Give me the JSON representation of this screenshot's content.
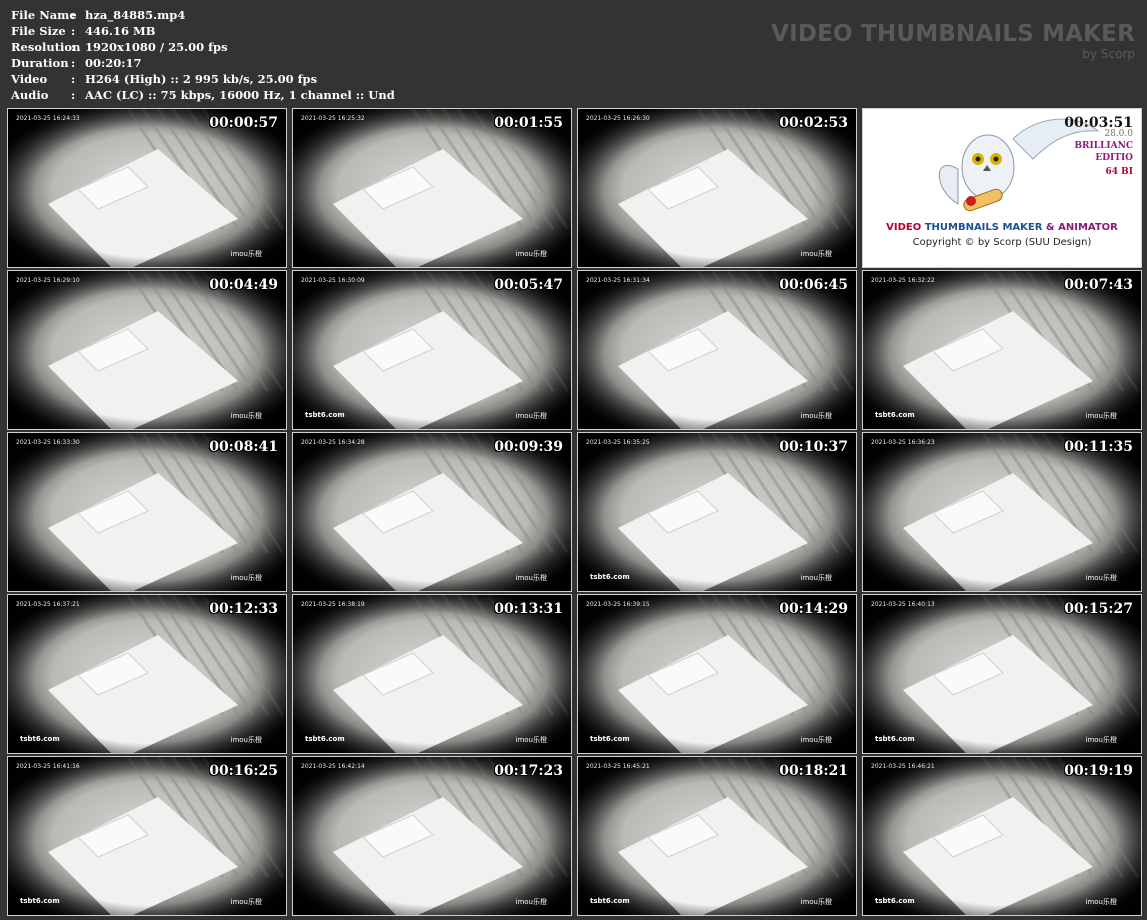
{
  "meta": [
    {
      "key": "File Name",
      "sep": ":",
      "value": "hza_84885.mp4"
    },
    {
      "key": "File Size",
      "sep": ":",
      "value": "446.16 MB"
    },
    {
      "key": "Resolution",
      "sep": ":",
      "value": "1920x1080 / 25.00 fps"
    },
    {
      "key": "Duration",
      "sep": ":",
      "value": "00:20:17"
    },
    {
      "key": "Video",
      "sep": ":",
      "value": "H264 (High) :: 2 995 kb/s, 25.00 fps"
    },
    {
      "key": "Audio",
      "sep": ":",
      "value": "AAC (LC) :: 75 kbps, 16000 Hz, 1 channel :: Und"
    }
  ],
  "brand": {
    "title": "VIDEO THUMBNAILS MAKER",
    "subtitle": "by Scorp"
  },
  "thumbnail_osd": "2021-03-25 16:24:33",
  "thumbnail_watermark": "imou乐橙",
  "thumbnails": [
    {
      "timestamp": "00:00:57",
      "osd": "2021-03-25 16:24:33",
      "watermark": "imou乐橙"
    },
    {
      "timestamp": "00:01:55",
      "osd": "2021-03-25 16:25:32",
      "watermark": "imou乐橙"
    },
    {
      "timestamp": "00:02:53",
      "osd": "2021-03-25 16:26:30",
      "watermark": "imou乐橙"
    },
    {
      "timestamp": "00:03:51",
      "logo": true
    },
    {
      "timestamp": "00:04:49",
      "osd": "2021-03-25 16:29:10",
      "watermark": "imou乐橙"
    },
    {
      "timestamp": "00:05:47",
      "osd": "2021-03-25 16:30:09",
      "watermark": "imou乐橙",
      "site": "tsbt6.com"
    },
    {
      "timestamp": "00:06:45",
      "osd": "2021-03-25 16:31:34",
      "watermark": "imou乐橙"
    },
    {
      "timestamp": "00:07:43",
      "osd": "2021-03-25 16:32:22",
      "watermark": "imou乐橙",
      "site": "tsbt6.com"
    },
    {
      "timestamp": "00:08:41",
      "osd": "2021-03-25 16:33:30",
      "watermark": "imou乐橙"
    },
    {
      "timestamp": "00:09:39",
      "osd": "2021-03-25 16:34:28",
      "watermark": "imou乐橙"
    },
    {
      "timestamp": "00:10:37",
      "osd": "2021-03-25 16:35:25",
      "watermark": "imou乐橙",
      "site": "tsbt6.com"
    },
    {
      "timestamp": "00:11:35",
      "osd": "2021-03-25 16:36:23",
      "watermark": "imou乐橙"
    },
    {
      "timestamp": "00:12:33",
      "osd": "2021-03-25 16:37:21",
      "watermark": "imou乐橙",
      "site": "tsbt6.com"
    },
    {
      "timestamp": "00:13:31",
      "osd": "2021-03-25 16:38:19",
      "watermark": "imou乐橙",
      "site": "tsbt6.com"
    },
    {
      "timestamp": "00:14:29",
      "osd": "2021-03-25 16:39:15",
      "watermark": "imou乐橙",
      "site": "tsbt6.com"
    },
    {
      "timestamp": "00:15:27",
      "osd": "2021-03-25 16:40:13",
      "watermark": "imou乐橙",
      "site": "tsbt6.com"
    },
    {
      "timestamp": "00:16:25",
      "osd": "2021-03-25 16:41:16",
      "watermark": "imou乐橙",
      "site": "tsbt6.com"
    },
    {
      "timestamp": "00:17:23",
      "osd": "2021-03-25 16:42:14",
      "watermark": "imou乐橙"
    },
    {
      "timestamp": "00:18:21",
      "osd": "2021-03-25 16:45:21",
      "watermark": "imou乐橙",
      "site": "tsbt6.com"
    },
    {
      "timestamp": "00:19:19",
      "osd": "2021-03-25 16:46:21",
      "watermark": "imou乐橙",
      "site": "tsbt6.com"
    }
  ],
  "logo_card": {
    "line1_a": "VIDEO ",
    "line1_b": "THUMBNAILS MAKER",
    "line1_c": " & ANIMATOR",
    "line2": "Copyright © by Scorp (SUU Design)",
    "version": "28.0.0",
    "edition1": "BRILLIANC",
    "edition2": "EDITIO",
    "bits": "64 BI"
  },
  "colors": {
    "background": "#333333",
    "brand_gray": "#5a5a5a",
    "logo_red": "#b8002a",
    "logo_blue": "#1d4f91",
    "logo_purple": "#8a1a7a"
  }
}
